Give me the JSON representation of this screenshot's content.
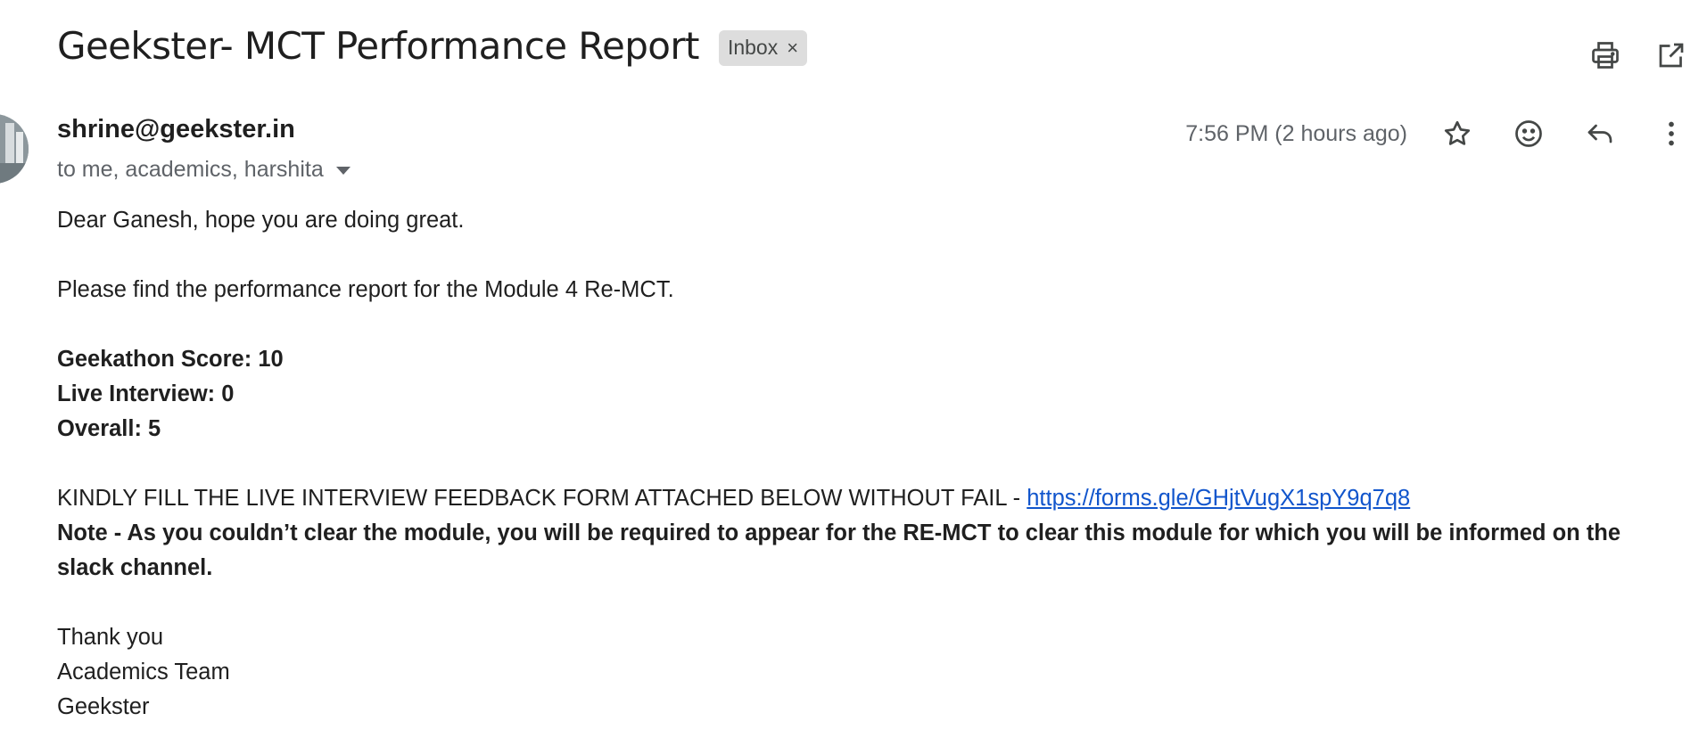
{
  "header": {
    "subject": "Geekster- MCT Performance Report",
    "label": "Inbox",
    "label_remove": "×",
    "actions": [
      {
        "name": "print-icon"
      },
      {
        "name": "open-in-new-window-icon"
      }
    ]
  },
  "message": {
    "sender": "shrine@geekster.in",
    "recipients": "to me, academics, harshita",
    "timestamp": "7:56 PM (2 hours ago)",
    "actions": [
      "star-icon",
      "emoji-icon",
      "reply-icon",
      "more-vert-icon"
    ]
  },
  "body": {
    "greeting": "Dear Ganesh, hope you are doing great.",
    "intro": "Please find the performance report for the Module 4 Re-MCT.",
    "scores": [
      "Geekathon Score: 10",
      "Live Interview: 0",
      "Overall: 5"
    ],
    "feedback_text": "KINDLY FILL THE LIVE INTERVIEW FEEDBACK FORM ATTACHED BELOW WITHOUT FAIL - ",
    "feedback_link": "https://forms.gle/GHjtVugX1spY9q7q8",
    "note": "Note - As you couldn’t clear the module, you will be required to appear for the RE-MCT to clear this module for which you will be informed on the slack channel.",
    "signoff": [
      "Thank you",
      "Academics Team",
      "Geekster"
    ]
  },
  "colors": {
    "link": "#1155cc",
    "chip_bg": "#dddddd",
    "muted_text": "#5f6368"
  }
}
